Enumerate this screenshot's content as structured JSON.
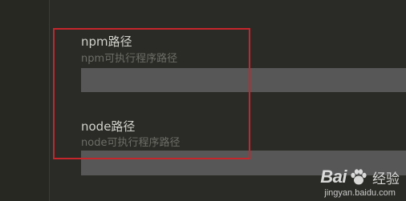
{
  "settings": {
    "npm": {
      "title": "npm路径",
      "description": "npm可执行程序路径",
      "value": ""
    },
    "node": {
      "title": "node路径",
      "description": "node可执行程序路径",
      "value": ""
    }
  },
  "annotation": {
    "highlight_color": "#c5262c"
  },
  "watermark": {
    "logo_prefix": "Bai",
    "logo_suffix": "经验",
    "url": "jingyan.baidu.com",
    "logo_icon": "paw-icon"
  },
  "colors": {
    "background": "#272822",
    "input_background": "#575757",
    "title_text": "#d2d2cc",
    "description_text": "#6e6e68"
  }
}
